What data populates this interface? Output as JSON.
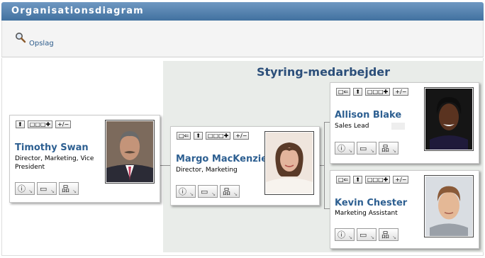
{
  "window": {
    "title": "Organisationsdiagram"
  },
  "toolbar": {
    "lookup_label": "Opslag",
    "lookup_icon": "magnifier-icon"
  },
  "team": {
    "title": "Styring-medarbejder"
  },
  "nav": {
    "peer": "□⇐",
    "up": "⬆",
    "peers": "□□□✚",
    "collapse": "+/−"
  },
  "actions": {
    "info": "ⓘ",
    "email": "▭",
    "org": "品",
    "corner": "↘"
  },
  "persons": {
    "timothy": {
      "name": "Timothy Swan",
      "title": "Director, Marketing, Vice President"
    },
    "margo": {
      "name": "Margo MacKenzie",
      "title": "Director, Marketing"
    },
    "allison": {
      "name": "Allison Blake",
      "title": "Sales Lead"
    },
    "kevin": {
      "name": "Kevin Chester",
      "title": "Marketing Assistant"
    }
  },
  "colors": {
    "header_top": "#6f98c2",
    "header_bottom": "#41719f",
    "name_blue": "#2d5f91",
    "team_bg": "#e9ece9"
  }
}
